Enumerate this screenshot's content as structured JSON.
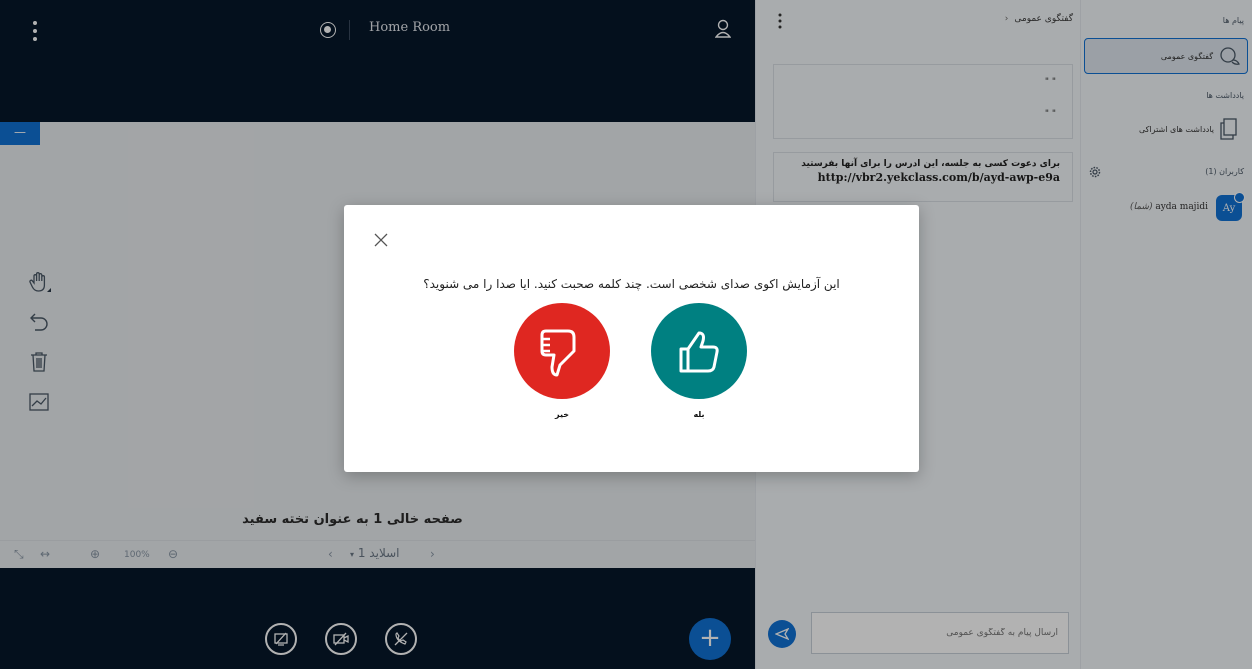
{
  "header": {
    "room_name": "Home Room"
  },
  "slide": {
    "minimize_label": "—",
    "title": "صفحه خالی 1 به عنوان تخته سفید",
    "zoom_value": "100%",
    "current_slide_label": "اسلاید 1"
  },
  "chat": {
    "title": "گفتگوی عمومی",
    "quote_line_1": "\" \"",
    "quote_line_2": "\" \"",
    "invite_text": "برای دعوت کسی به جلسه، این ادرس را برای آنها بفرستید",
    "invite_link": "http://vbr2.yekclass.com/b/ayd-awp-e9a",
    "input_placeholder": "ارسال پیام به گفتگوی عمومی"
  },
  "userlist": {
    "messages_heading": "پیام ها",
    "public_chat_label": "گفتگوی عمومی",
    "notes_heading": "یادداشت ها",
    "shared_notes_label": "یادداشت های اشتراکی",
    "users_heading": "کاربران (1)",
    "user_name": "ayda majidi",
    "user_you": "(شما)",
    "user_initials": "Ay"
  },
  "modal": {
    "question": "این آزمایش اکوی صدای شخصی است. چند کلمه صحبت کنید. ایا صدا را می شنوید؟",
    "no_label": "خیر",
    "yes_label": "بله"
  },
  "colors": {
    "dark_navy": "#06172a",
    "accent_blue": "#1172d5",
    "no_red": "#df2721",
    "yes_teal": "#008081"
  }
}
